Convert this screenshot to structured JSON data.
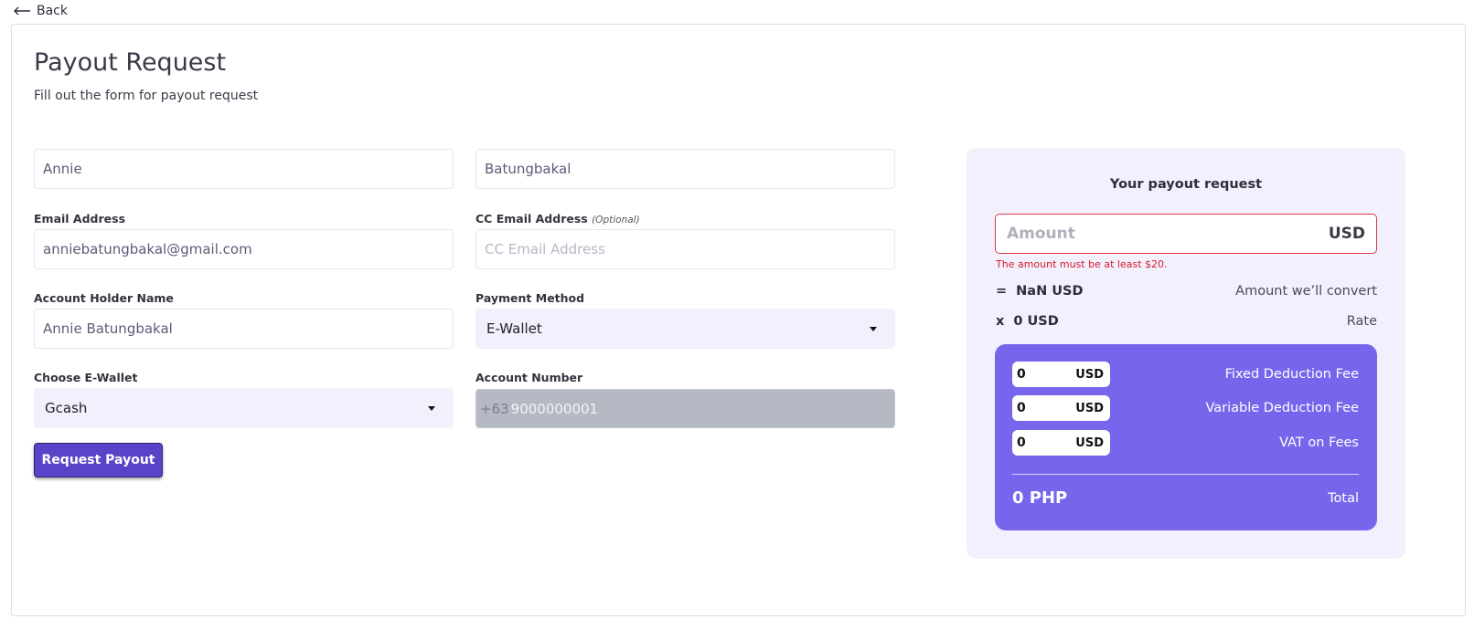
{
  "nav": {
    "back_label": "Back"
  },
  "header": {
    "title": "Payout Request",
    "subtitle": "Fill out the form for payout request"
  },
  "form": {
    "first_name": {
      "value": "Annie"
    },
    "last_name": {
      "value": "Batungbakal"
    },
    "email": {
      "label": "Email Address",
      "value": "anniebatungbakal@gmail.com"
    },
    "cc_email": {
      "label": "CC Email Address",
      "optional": "(Optional)",
      "placeholder": "CC Email Address"
    },
    "account_holder": {
      "label": "Account Holder Name",
      "value": "Annie Batungbakal"
    },
    "payment_method": {
      "label": "Payment Method",
      "selected": "E-Wallet"
    },
    "ewallet": {
      "label": "Choose E-Wallet",
      "selected": "Gcash"
    },
    "account_number": {
      "label": "Account Number",
      "prefix": "+63",
      "value": "9000000001"
    },
    "submit_label": "Request Payout"
  },
  "summary": {
    "title": "Your payout request",
    "amount": {
      "placeholder": "Amount",
      "currency": "USD",
      "error": "The amount must be at least $20."
    },
    "convert": {
      "operator": "=",
      "value": "NaN USD",
      "label": "Amount we’ll convert"
    },
    "rate": {
      "operator": "x",
      "value": "0 USD",
      "label": "Rate"
    },
    "fees": [
      {
        "value": "0",
        "currency": "USD",
        "label": "Fixed Deduction Fee"
      },
      {
        "value": "0",
        "currency": "USD",
        "label": "Variable Deduction Fee"
      },
      {
        "value": "0",
        "currency": "USD",
        "label": "VAT on Fees"
      }
    ],
    "total": {
      "value": "0 PHP",
      "label": "Total"
    }
  },
  "colors": {
    "accent": "#5a43c9",
    "fee_panel": "#7766ec",
    "summary_bg": "#f1f0fc",
    "error": "#d61c2d"
  }
}
